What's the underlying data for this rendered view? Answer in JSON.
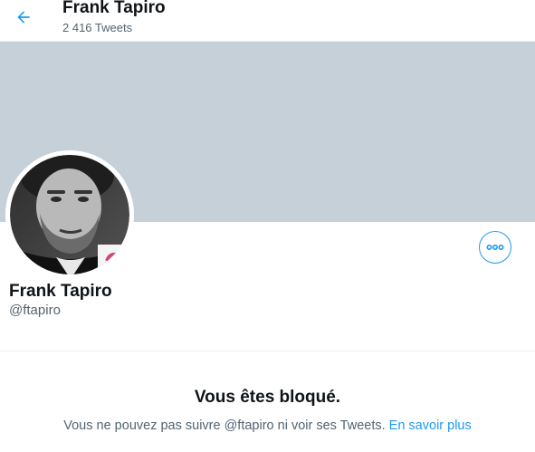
{
  "header": {
    "title": "Frank Tapiro",
    "tweet_count": "2 416 Tweets",
    "back_icon": "arrow-left-icon"
  },
  "colors": {
    "accent": "#1d9bf0",
    "banner": "#c6d0d9",
    "secondary_text": "#536471"
  },
  "profile": {
    "name": "Frank Tapiro",
    "handle": "@ftapiro",
    "avatar_icon": "profile-photo",
    "more_icon": "more-horizontal-icon"
  },
  "blocked": {
    "title": "Vous êtes bloqué.",
    "message": "Vous ne pouvez pas suivre @ftapiro ni voir ses Tweets.",
    "link_label": "En savoir plus"
  }
}
